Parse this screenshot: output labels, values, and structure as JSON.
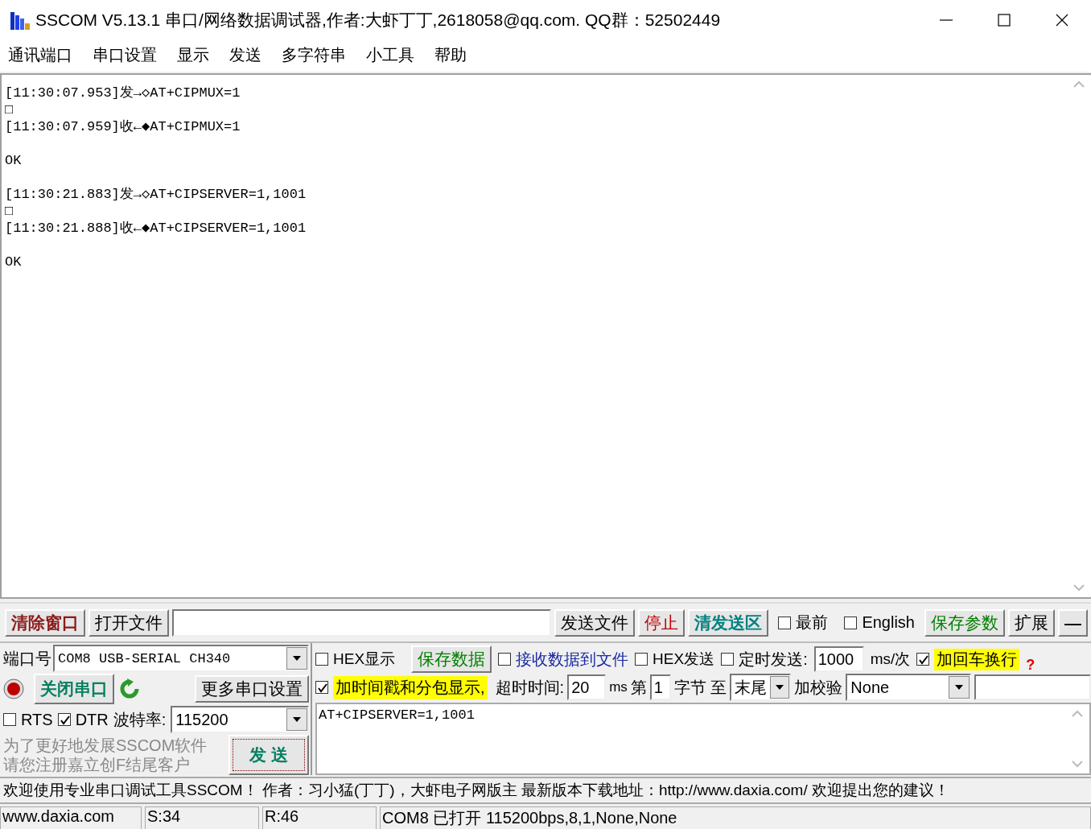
{
  "window": {
    "title": "SSCOM V5.13.1 串口/网络数据调试器,作者:大虾丁丁,2618058@qq.com. QQ群：52502449"
  },
  "menu": [
    "通讯端口",
    "串口设置",
    "显示",
    "发送",
    "多字符串",
    "小工具",
    "帮助"
  ],
  "log_blocks": [
    [
      "[11:30:07.953]发→◇AT+CIPMUX=1",
      "□",
      "[11:30:07.959]收←◆AT+CIPMUX=1"
    ],
    [
      "OK"
    ],
    [
      "[11:30:21.883]发→◇AT+CIPSERVER=1,1001",
      "□",
      "[11:30:21.888]收←◆AT+CIPSERVER=1,1001"
    ],
    [
      "OK"
    ]
  ],
  "toolbar": [
    {
      "kind": "button",
      "label": "清除窗口",
      "color": "#8b1a1a",
      "bold": true
    },
    {
      "kind": "button",
      "label": "打开文件",
      "color": "#000000",
      "bold": false
    },
    {
      "kind": "field"
    },
    {
      "kind": "button",
      "label": "发送文件",
      "color": "#000000",
      "bold": false
    },
    {
      "kind": "button",
      "label": "停止",
      "color": "#c00000",
      "bold": false
    },
    {
      "kind": "button",
      "label": "清发送区",
      "color": "#008080",
      "bold": true
    },
    {
      "kind": "checkbox",
      "label": "最前",
      "checked": false
    },
    {
      "kind": "checkbox",
      "label": "English",
      "checked": false
    },
    {
      "kind": "button",
      "label": "保存参数",
      "color": "#008000",
      "bold": false
    },
    {
      "kind": "button",
      "label": "扩展",
      "color": "#000000",
      "bold": false
    },
    {
      "kind": "button",
      "label": "—",
      "color": "#000000",
      "bold": true
    }
  ],
  "port_panel": {
    "port_label": "端口号",
    "port_value": "COM8 USB-SERIAL CH340",
    "open": true,
    "close_button": "关闭串口",
    "more_settings": "更多串口设置",
    "rts": {
      "label": "RTS",
      "checked": false
    },
    "dtr": {
      "label": "DTR",
      "checked": true
    },
    "baud_label": "波特率:",
    "baud_value": "115200",
    "promo": [
      "为了更好地发展SSCOM软件",
      "请您注册嘉立创F结尾客户"
    ],
    "send_button": "发 送"
  },
  "options": {
    "hex_display": {
      "label": "HEX显示",
      "checked": false
    },
    "save_data": "保存数据",
    "receive_to_file": {
      "label": "接收数据到文件",
      "checked": false
    },
    "hex_send": {
      "label": "HEX发送",
      "checked": false
    },
    "timed_send": {
      "label": "定时发送:",
      "checked": false
    },
    "interval": "1000",
    "interval_unit": "ms/次",
    "add_newline": {
      "label": "加回车换行",
      "checked": true
    },
    "help": "?",
    "timestamp": {
      "label": "加时间戳和分包显示,",
      "checked": true
    },
    "timeout_label": "超时时间:",
    "timeout": "20",
    "timeout_unit": "ms",
    "from_label": "第",
    "from_value": "1",
    "to_label": "字节 至",
    "to_value": "末尾",
    "checksum_label": "加校验",
    "checksum_value": "None"
  },
  "send_text": "AT+CIPSERVER=1,1001",
  "ticker": "欢迎使用专业串口调试工具SSCOM！ 作者：习小猛(丁丁)，大虾电子网版主 最新版本下载地址：http://www.daxia.com/ 欢迎提出您的建议！",
  "status_bar": [
    "www.daxia.com",
    "S:34",
    "R:46",
    "COM8 已打开  115200bps,8,1,None,None"
  ]
}
